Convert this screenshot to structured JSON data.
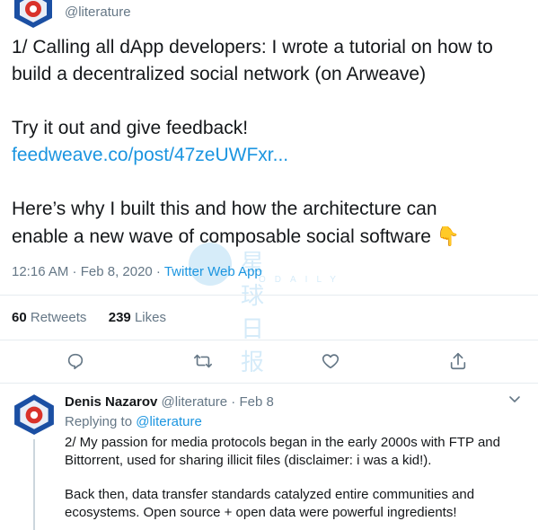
{
  "author": {
    "handle": "@literature"
  },
  "tweet": {
    "lines": [
      "1/ Calling all dApp developers: I wrote a tutorial on how to",
      "build a decentralized social network (on Arweave)",
      "Try it out and give feedback!",
      "feedweave.co/post/47zeUWFxr...",
      "Here’s why I built this and how the architecture can",
      "enable a new wave of composable social software"
    ],
    "emoji": "👇",
    "time": "12:16 AM · Feb 8, 2020 · ",
    "via": "Twitter Web App"
  },
  "stats": {
    "retweets_count": "60",
    "retweets_label": "Retweets",
    "likes_count": "239",
    "likes_label": "Likes"
  },
  "actions": [
    "reply-icon",
    "retweet-icon",
    "like-icon",
    "share-icon"
  ],
  "watermark": {
    "cn": "星球日报",
    "en": "ODAILY"
  },
  "reply": {
    "name": "Denis Nazarov",
    "meta": "@literature · Feb 8",
    "replying_prefix": "Replying to ",
    "replying_handle": "@literature",
    "lines": [
      "2/ My passion for media protocols began in the early 2000s with FTP and",
      "Bittorrent, used for sharing illicit files (disclaimer: i was a kid!).",
      "Back then, data transfer standards catalyzed entire communities and",
      "ecosystems. Open source + open data were powerful ingredients!"
    ]
  },
  "colors": {
    "link": "#1b95e0",
    "muted": "#657786",
    "divider": "#e6ecf0",
    "avatar_blue": "#1b4fa3",
    "avatar_red": "#d9322a"
  }
}
